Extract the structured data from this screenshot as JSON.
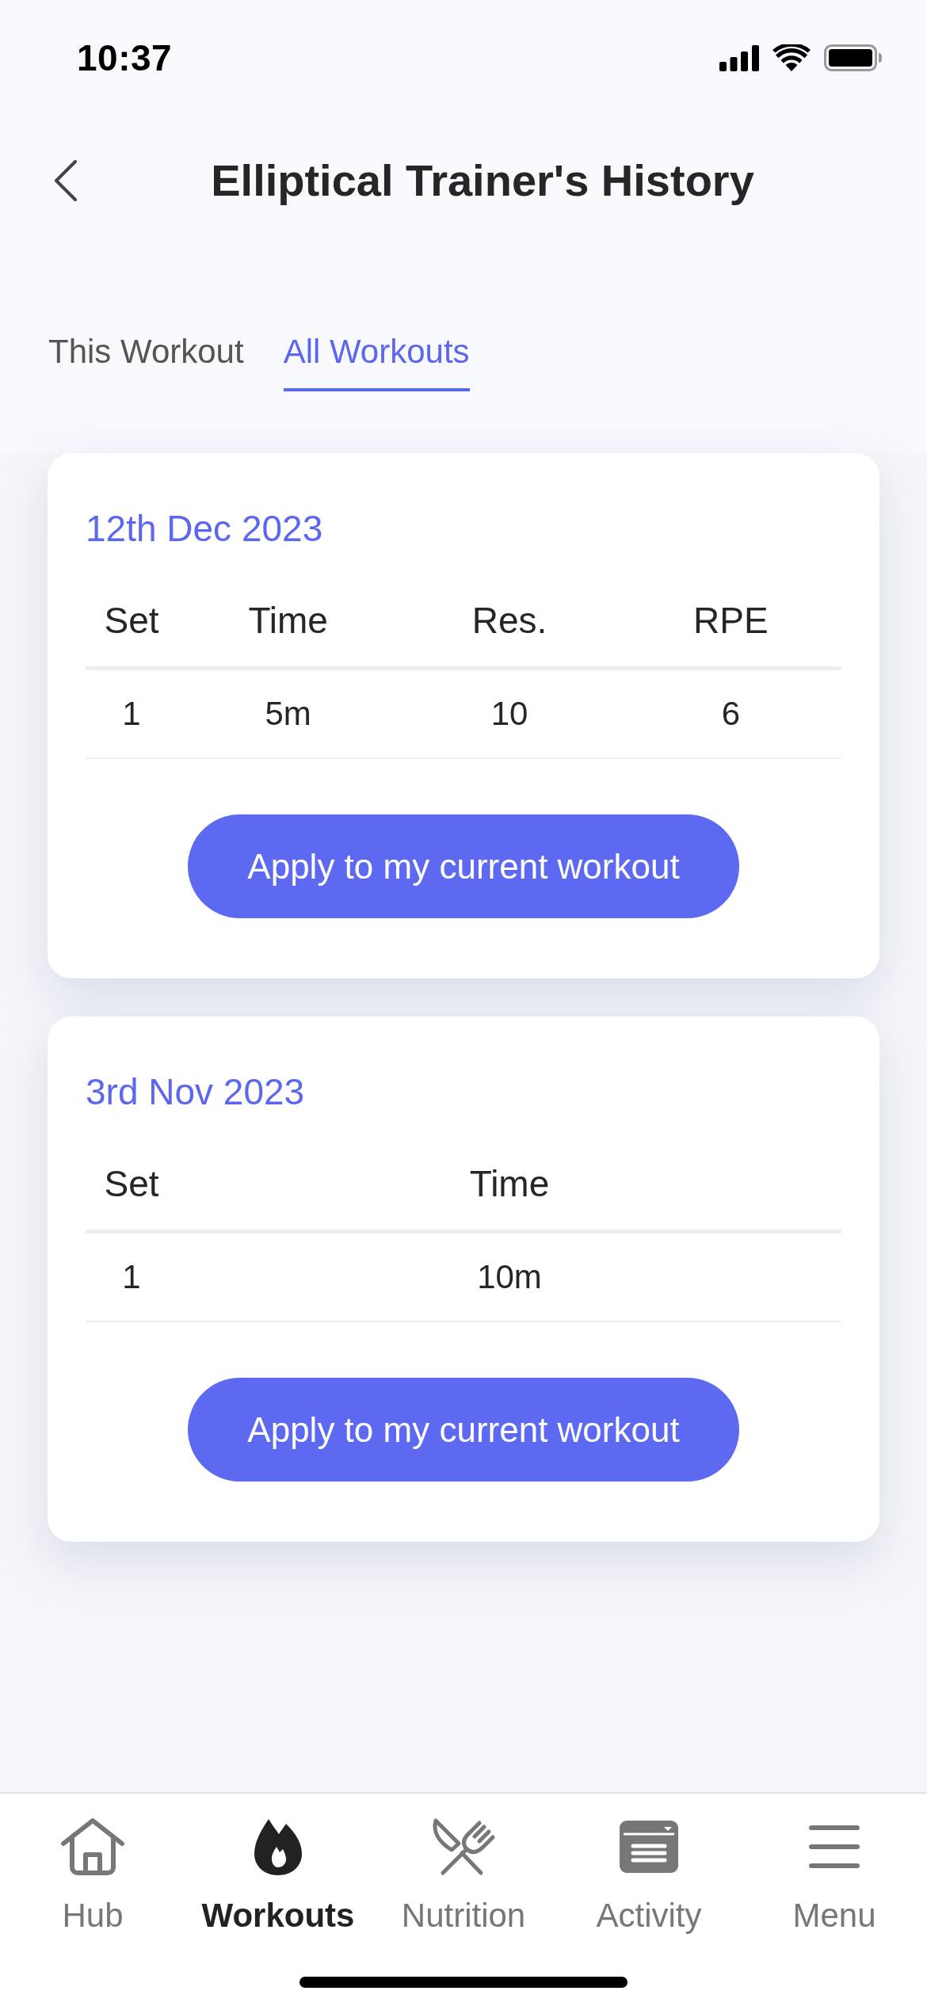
{
  "status_bar": {
    "time": "10:37"
  },
  "header": {
    "title": "Elliptical Trainer's History"
  },
  "tabs": [
    {
      "label": "This Workout",
      "selected": false
    },
    {
      "label": "All Workouts",
      "selected": true
    }
  ],
  "workouts": [
    {
      "date": "12th Dec 2023",
      "table": {
        "columns": [
          "Set",
          "Time",
          "Res.",
          "RPE"
        ],
        "rows": [
          [
            "1",
            "5m",
            "10",
            "6"
          ]
        ]
      },
      "button": "Apply to my current workout"
    },
    {
      "date": "3rd Nov 2023",
      "table": {
        "columns": [
          "Set",
          "Time"
        ],
        "rows": [
          [
            "1",
            "10m"
          ]
        ]
      },
      "button": "Apply to my current workout"
    }
  ],
  "bottom_nav": [
    {
      "label": "Hub",
      "selected": false
    },
    {
      "label": "Workouts",
      "selected": true
    },
    {
      "label": "Nutrition",
      "selected": false
    },
    {
      "label": "Activity",
      "selected": false
    },
    {
      "label": "Menu",
      "selected": false
    }
  ]
}
